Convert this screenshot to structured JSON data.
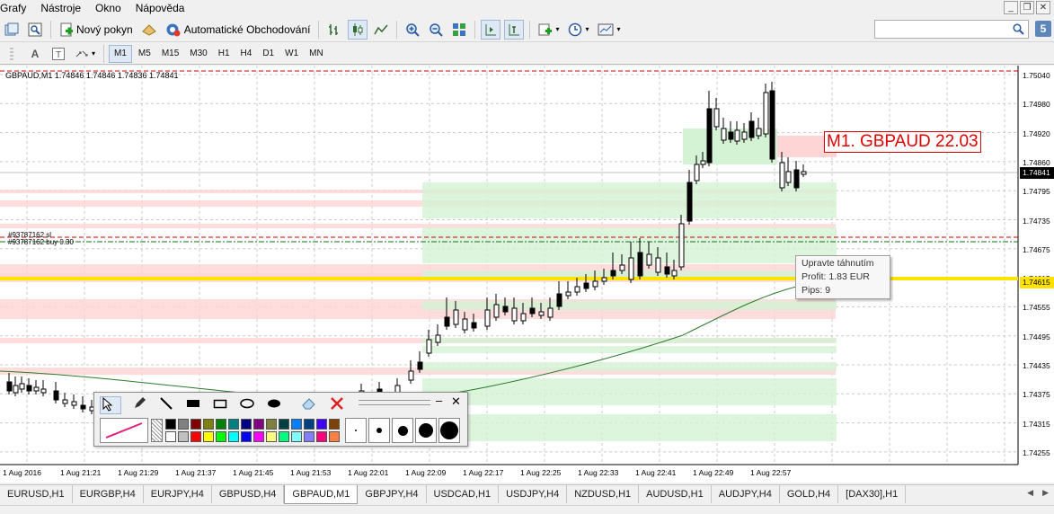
{
  "menu": [
    "Grafy",
    "Nástroje",
    "Okno",
    "Nápověda"
  ],
  "window_controls": [
    "_",
    "❐",
    "✕"
  ],
  "toolbar": {
    "new_order_label": "Nový pokyn",
    "auto_trading_label": "Automatické Obchodování"
  },
  "search": {
    "value": "",
    "placeholder": ""
  },
  "help_label": "5",
  "timeframes": [
    "M1",
    "M5",
    "M15",
    "M30",
    "H1",
    "H4",
    "D1",
    "W1",
    "MN"
  ],
  "active_timeframe": "M1",
  "chart": {
    "header": "GBPAUD,M1  1.74846 1.74846 1.74836 1.74841",
    "price_label": "M1. GBPAUD 22.03",
    "order_label_1": "#93787162 sl",
    "order_label_2": "#93787162 buy 0.30",
    "y_labels": [
      "1.75040",
      "1.74980",
      "1.74920",
      "1.74860",
      "1.74795",
      "1.74735",
      "1.74675",
      "1.74615",
      "1.74555",
      "1.74495",
      "1.74435",
      "1.74375",
      "1.74315",
      "1.74255"
    ],
    "current_price": "1.74841",
    "yellow_price": "1.74615",
    "x_labels": [
      "1 Aug 2016",
      "1 Aug 21:21",
      "1 Aug 21:29",
      "1 Aug 21:37",
      "1 Aug 21:45",
      "1 Aug 21:53",
      "1 Aug 22:01",
      "1 Aug 22:09",
      "1 Aug 22:17",
      "1 Aug 22:25",
      "1 Aug 22:33",
      "1 Aug 22:41",
      "1 Aug 22:49",
      "1 Aug 22:57"
    ]
  },
  "tooltip": {
    "title": "Upravte táhnutím",
    "profit": "Profit: 1.83 EUR",
    "pips": "Pips: 9"
  },
  "drawing_panel": {
    "colors_row1": [
      "#000000",
      "#808080",
      "#800000",
      "#808000",
      "#008000",
      "#008080",
      "#000080",
      "#800080",
      "#808040",
      "#004040",
      "#0080ff",
      "#004080",
      "#4000ff",
      "#804000"
    ],
    "colors_row2": [
      "#ffffff",
      "#c0c0c0",
      "#ff0000",
      "#ffff00",
      "#00ff00",
      "#00ffff",
      "#0000ff",
      "#ff00ff",
      "#ffff80",
      "#00ff80",
      "#80ffff",
      "#8080ff",
      "#ff0080",
      "#ff8040"
    ]
  },
  "tabs": [
    "EURUSD,H1",
    "EURGBP,H4",
    "EURJPY,H4",
    "GBPUSD,H4",
    "GBPAUD,M1",
    "GBPJPY,H4",
    "USDCAD,H1",
    "USDJPY,H4",
    "NZDUSD,H1",
    "AUDUSD,H1",
    "AUDJPY,H4",
    "GOLD,H4",
    "[DAX30],H1"
  ],
  "active_tab": "GBPAUD,M1"
}
